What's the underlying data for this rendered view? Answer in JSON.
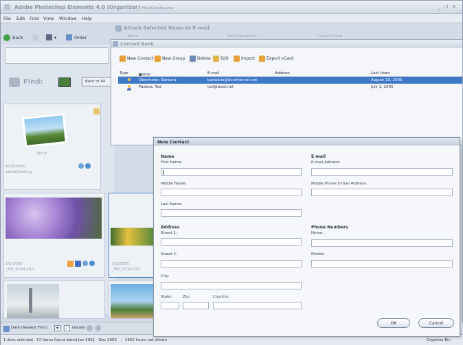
{
  "app": {
    "title": "Adobe Photoshop Elements 4.0 (Organizer)",
    "subtitle": "MainCatalog.psa",
    "min_label": "_",
    "restore_label": "❐",
    "close_label": "✕"
  },
  "menu": [
    "File",
    "Edit",
    "Find",
    "View",
    "Window",
    "Help"
  ],
  "attach_bar": "Attach Selected Items to E-mail",
  "ghost_cols": [
    "Name",
    "Select Recipients",
    "Choose Format"
  ],
  "toolbar": {
    "back": "Back",
    "order": "Order"
  },
  "find": {
    "label": "Find:",
    "back_to_all": "Back to All"
  },
  "thumbs": [
    {
      "caption_title": "Aloha",
      "date": "8/10/2005",
      "name": "alohaGreeting"
    },
    {
      "date": "5/1/2005",
      "name": "_MG_0199.CR2"
    },
    {
      "date": "5/1/2005",
      "name": "_MG_0210.CR2"
    }
  ],
  "bottom_toolbar": {
    "sort": "Date (Newest First)",
    "details": "Details"
  },
  "status": {
    "selected": "1 item selected",
    "found": "17 items found dated Jan 2001 - Dec 2005",
    "not_shown": "1652 items not shown",
    "organize_bin": "Organize Bin"
  },
  "contact_book": {
    "title": "Contact Book",
    "tools": [
      "New Contact",
      "New Group",
      "Delete",
      "Edit",
      "Import",
      "Export vCard"
    ],
    "columns": [
      "Type",
      "Name",
      "E-mail",
      "Address",
      "Last Used"
    ],
    "rows": [
      {
        "name": "Obermeier, Barbara",
        "email": "barbobie@dcninternet.net",
        "address": "",
        "last_used": "August 10, 2005",
        "selected": true
      },
      {
        "name": "Padova, Ted",
        "email": "ted@west.net",
        "address": "",
        "last_used": "July 1, 2005",
        "selected": false
      }
    ]
  },
  "new_contact": {
    "title": "New Contact",
    "name_section": "Name",
    "first_name": "First Name:",
    "middle_name": "Middle Name:",
    "last_name": "Last Name:",
    "address_section": "Address",
    "street1": "Street 1:",
    "street2": "Street 2:",
    "city": "City:",
    "state": "State:",
    "zip": "Zip:",
    "country": "Country:",
    "email_section": "E-mail",
    "email_address": "E-mail Address:",
    "mobile_email": "Mobile Phone E-mail Address:",
    "phone_section": "Phone Numbers",
    "home": "Home:",
    "mobile": "Mobile:",
    "ok": "OK",
    "cancel": "Cancel"
  },
  "colors": {
    "selection": "#3d78c9",
    "accent_green": "#43a047",
    "window_bg": "#d3dbe7"
  }
}
